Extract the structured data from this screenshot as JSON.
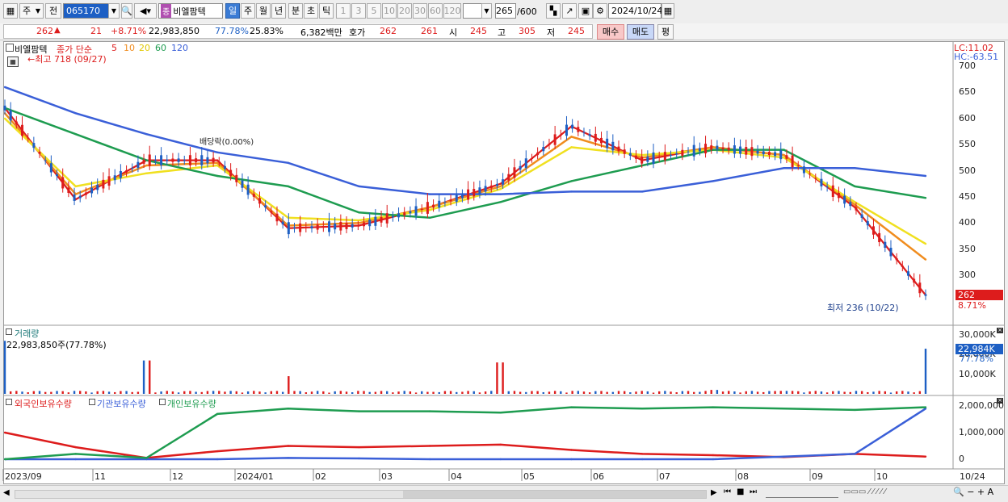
{
  "toolbar": {
    "period_type": "주",
    "prev_label": "전",
    "code": "065170",
    "stock_name": "비엘팜텍",
    "tag_label": "종",
    "periods": [
      "일",
      "주",
      "월",
      "년",
      "분",
      "초",
      "틱"
    ],
    "active_period": "일",
    "intervals": [
      "1",
      "3",
      "5",
      "10",
      "20",
      "30",
      "60",
      "120"
    ],
    "count_current": "265",
    "count_total": "/600",
    "date": "2024/10/24"
  },
  "quote": {
    "price": "262",
    "change_arrow": "▲",
    "change": "21",
    "change_pct": "+8.71%",
    "volume": "22,983,850",
    "volume_ratio": "77.78%",
    "turnover": "25.83%",
    "amount": "6,382백만",
    "hoga_label": "호가",
    "ask": "262",
    "bid": "261",
    "open_label": "시",
    "open": "245",
    "high_label": "고",
    "high": "305",
    "low_label": "저",
    "low": "245",
    "buy_label": "매수",
    "sell_label": "매도",
    "eval_label": "평"
  },
  "price_panel": {
    "name": "비엘팜텍",
    "legend_prefix": "종가 단순",
    "ma_labels": [
      "5",
      "10",
      "20",
      "60",
      "120"
    ],
    "ma_colors": [
      "#dd1c1c",
      "#f08c1e",
      "#f0e020",
      "#1e9c50",
      "#3a5fd8"
    ],
    "high_note": "←최고 718 (09/27)",
    "low_note": "최저 236 (10/22)",
    "dividend_note": "배당락(0.00%)",
    "lc": "LC:11.02",
    "hc": "HC:-63.51",
    "yticks": [
      "700",
      "650",
      "600",
      "550",
      "500",
      "450",
      "400",
      "350",
      "300"
    ],
    "last_price_tag": "262",
    "last_pct_tag": "8.71%"
  },
  "volume_panel": {
    "title": "거래량",
    "value_note": "22,983,850주(77.78%)",
    "yticks": [
      "30,000K",
      "20,000K",
      "10,000K"
    ],
    "last_tag": "22,984K",
    "last_pct": "77.78%"
  },
  "holding_panel": {
    "legend": [
      "외국인보유수량",
      "기관보유수량",
      "개인보유수량"
    ],
    "legend_colors": [
      "#dd1c1c",
      "#3a5fd8",
      "#1e9c50"
    ],
    "yticks": [
      "2,000,000",
      "1,000,000",
      "0"
    ]
  },
  "xaxis": {
    "labels": [
      "2023/09",
      "11",
      "12",
      "2024/01",
      "02",
      "03",
      "04",
      "05",
      "06",
      "07",
      "08",
      "09",
      "10"
    ],
    "right_label": "10/24"
  },
  "chart_data": [
    {
      "type": "line",
      "title": "",
      "ylabel": "",
      "ylim": [
        230,
        700
      ],
      "x": [
        "2023/09",
        "11",
        "12",
        "2024/01",
        "02",
        "03",
        "04",
        "05",
        "06",
        "07",
        "08",
        "09",
        "10",
        "10/24"
      ],
      "series": [
        {
          "name": "5",
          "values": [
            620,
            445,
            520,
            520,
            390,
            395,
            430,
            475,
            585,
            520,
            545,
            530,
            430,
            262
          ]
        },
        {
          "name": "10",
          "values": [
            610,
            455,
            510,
            515,
            395,
            400,
            430,
            470,
            565,
            525,
            545,
            530,
            435,
            330
          ]
        },
        {
          "name": "20",
          "values": [
            600,
            470,
            495,
            510,
            410,
            405,
            425,
            465,
            545,
            530,
            540,
            525,
            440,
            360
          ]
        },
        {
          "name": "60",
          "values": [
            620,
            570,
            520,
            490,
            470,
            420,
            410,
            440,
            480,
            510,
            540,
            540,
            470,
            448
          ]
        },
        {
          "name": "120",
          "values": [
            660,
            610,
            570,
            535,
            515,
            470,
            455,
            455,
            460,
            460,
            480,
            505,
            505,
            490
          ]
        }
      ]
    },
    {
      "type": "bar",
      "title": "",
      "ylabel": "",
      "ylim": [
        0,
        30000
      ],
      "x": [
        "2023/09",
        "11",
        "12",
        "2024/01",
        "02",
        "03",
        "04",
        "05",
        "06",
        "07",
        "08",
        "09",
        "10",
        "10/24"
      ],
      "series": [
        {
          "name": "",
          "values": [
            27000,
            1500,
            17000,
            1500,
            9000,
            1500,
            1000,
            16000,
            1500,
            1500,
            2000,
            1500,
            1500,
            22984
          ]
        }
      ]
    },
    {
      "type": "line",
      "title": "",
      "ylabel": "",
      "ylim": [
        -300000,
        2200000
      ],
      "x": [
        "2023/09",
        "11",
        "12",
        "2024/01",
        "02",
        "03",
        "04",
        "05",
        "06",
        "07",
        "08",
        "09",
        "10",
        "10/24"
      ],
      "series": [
        {
          "name": "외국인보유수량",
          "values": [
            1000000,
            450000,
            50000,
            300000,
            500000,
            450000,
            500000,
            550000,
            350000,
            200000,
            150000,
            80000,
            200000,
            100000
          ]
        },
        {
          "name": "기관보유수량",
          "values": [
            0,
            0,
            0,
            0,
            50000,
            30000,
            0,
            0,
            0,
            0,
            0,
            100000,
            200000,
            1900000
          ]
        },
        {
          "name": "개인보유수량",
          "values": [
            0,
            200000,
            50000,
            1700000,
            1900000,
            1800000,
            1800000,
            1750000,
            1950000,
            1900000,
            1950000,
            1900000,
            1850000,
            1950000
          ]
        }
      ]
    }
  ]
}
